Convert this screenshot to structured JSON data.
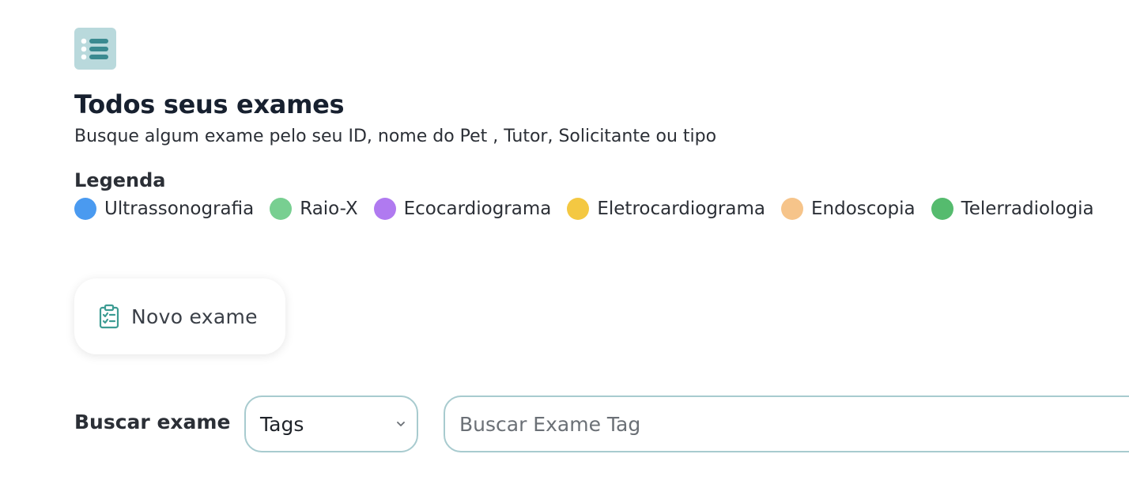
{
  "header": {
    "icon": "list-icon",
    "title": "Todos seus exames",
    "subtitle": "Busque algum exame pelo seu ID, nome do Pet , Tutor, Solicitante ou tipo"
  },
  "legend": {
    "title": "Legenda",
    "items": [
      {
        "label": "Ultrassonografia",
        "color": "#4a9af0"
      },
      {
        "label": "Raio-X",
        "color": "#78cf91"
      },
      {
        "label": "Ecocardiograma",
        "color": "#b07af0"
      },
      {
        "label": "Eletrocardiograma",
        "color": "#f4c842"
      },
      {
        "label": "Endoscopia",
        "color": "#f6c48a"
      },
      {
        "label": "Telerradiologia",
        "color": "#55bb6e"
      }
    ]
  },
  "actions": {
    "new_exam_label": "Novo exame",
    "new_exam_icon": "clipboard-check-icon"
  },
  "search": {
    "label": "Buscar exame",
    "filter_selected": "Tags",
    "input_value": "",
    "placeholder": "Buscar Exame Tag"
  },
  "colors": {
    "accent": "#3d9c93",
    "icon_bg": "#b9d9dc",
    "input_border": "#a8cbcf"
  }
}
